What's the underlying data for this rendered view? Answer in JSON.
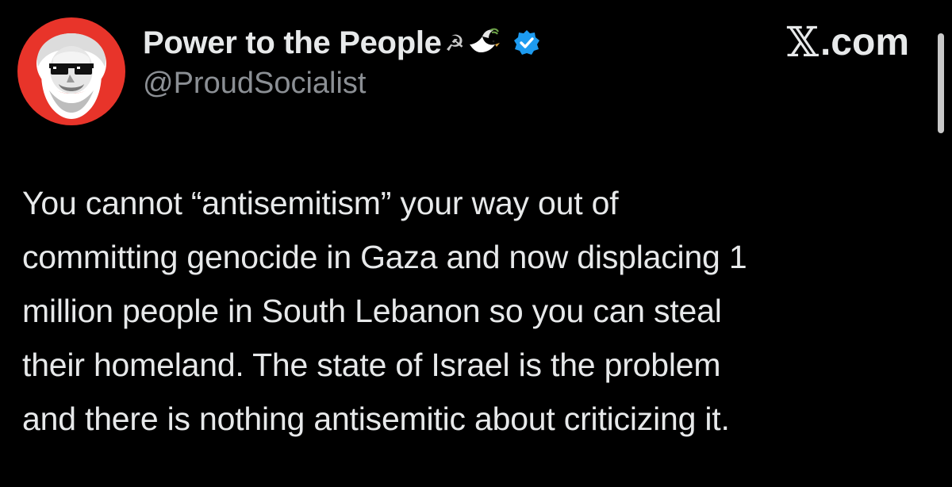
{
  "tweet": {
    "display_name": "Power to the People",
    "name_emojis": "☭",
    "handle": "@ProudSocialist",
    "brand": {
      "x_glyph": "𝕏",
      "domain": ".com"
    },
    "text": "You cannot “antisemitism” your way out of\ncommitting genocide in Gaza and now displacing 1\nmillion people in South Lebanon so you can steal\ntheir homeland. The state of Israel is the problem\nand there is nothing antisemitic about criticizing it.",
    "icons": {
      "avatar": "karl-marx-sunglasses-avatar",
      "verified": "verified-badge-icon",
      "dove": "dove-icon",
      "hammer_sickle": "hammer-sickle-icon"
    }
  },
  "colors": {
    "background": "#000000",
    "text": "#e7e9ea",
    "handle": "#8b8f94",
    "avatar_bg": "#e8342a",
    "verified": "#1d9bf0"
  }
}
